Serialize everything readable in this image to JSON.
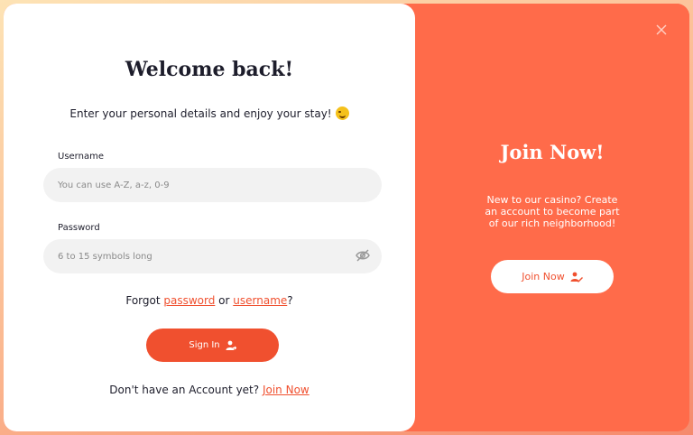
{
  "login": {
    "title": "Welcome back!",
    "subtitle": "Enter your personal details and enjoy your stay!",
    "username": {
      "label": "Username",
      "placeholder": "You can use A-Z, a-z, 0-9",
      "value": ""
    },
    "password": {
      "label": "Password",
      "placeholder": "6 to 15 symbols long",
      "value": ""
    },
    "forgot": {
      "prefix": "Forgot ",
      "password_link": "password",
      "middle": " or ",
      "username_link": "username",
      "suffix": "?"
    },
    "signin_label": "Sign In",
    "no_account": {
      "text": "Don't have an Account yet? ",
      "link": "Join Now"
    }
  },
  "join": {
    "title": "Join Now!",
    "text": "New to our casino? Create an account to become part of our rich neighborhood!",
    "button_label": "Join Now"
  },
  "icons": {
    "close": "close-icon",
    "eye": "eye-off-icon",
    "signin": "user-arrow-icon",
    "join": "user-edit-icon",
    "emoji": "winking-face-emoji"
  },
  "colors": {
    "accent": "#f0502f",
    "panel": "#ff6b4a",
    "text": "#1d1d2b",
    "input_bg": "#f2f2f2"
  }
}
